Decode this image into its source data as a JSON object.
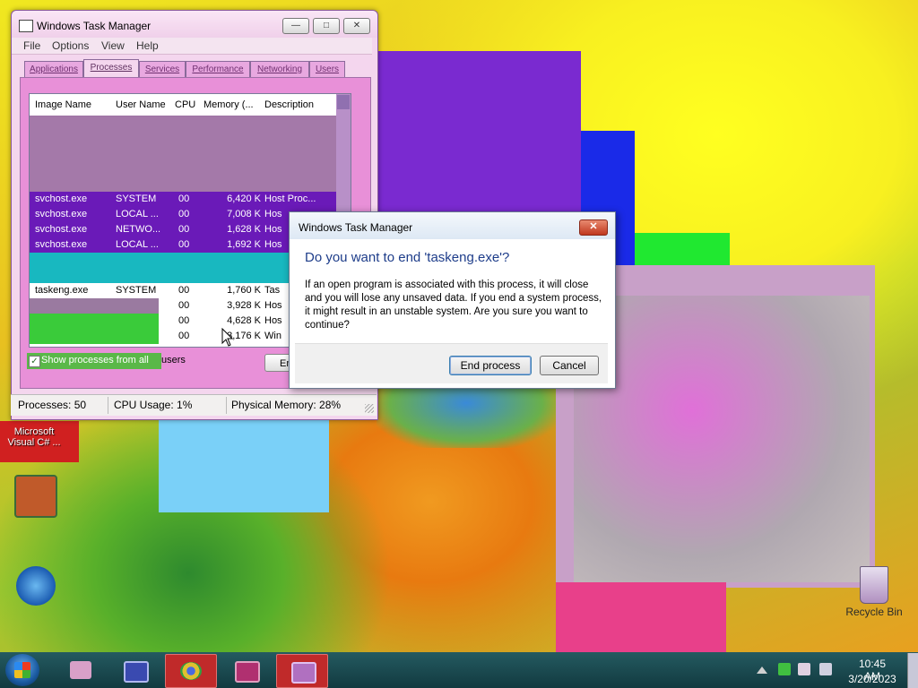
{
  "taskmanager": {
    "title": "Windows Task Manager",
    "menu": [
      "File",
      "Options",
      "View",
      "Help"
    ],
    "tabs": [
      "Applications",
      "Processes",
      "Services",
      "Performance",
      "Networking",
      "Users"
    ],
    "active_tab": "Processes",
    "columns": [
      "Image Name",
      "User Name",
      "CPU",
      "Memory (...",
      "Description"
    ],
    "rows": [
      {
        "image": "svchost.exe",
        "user": "SYSTEM",
        "cpu": "00",
        "mem": "6,420 K",
        "desc": "Host Proc...",
        "bg": "#6a1ab8",
        "fg": "#ffffff"
      },
      {
        "image": "svchost.exe",
        "user": "LOCAL ...",
        "cpu": "00",
        "mem": "7,008 K",
        "desc": "Hos",
        "bg": "#6a1ab8",
        "fg": "#ffffff"
      },
      {
        "image": "svchost.exe",
        "user": "NETWO...",
        "cpu": "00",
        "mem": "1,628 K",
        "desc": "Hos",
        "bg": "#6a1ab8",
        "fg": "#ffffff"
      },
      {
        "image": "svchost.exe",
        "user": "LOCAL ...",
        "cpu": "00",
        "mem": "1,692 K",
        "desc": "Hos",
        "bg": "#6a1ab8",
        "fg": "#ffffff"
      },
      {
        "image": "taskeng.exe",
        "user": "SYSTEM",
        "cpu": "00",
        "mem": "1,760 K",
        "desc": "Tas",
        "bg": "#ffffff",
        "fg": "#000000"
      },
      {
        "image": "",
        "user": "",
        "cpu": "00",
        "mem": "3,928 K",
        "desc": "Hos",
        "bg": "#ffffff",
        "fg": "#000000"
      },
      {
        "image": "",
        "user": "",
        "cpu": "00",
        "mem": "4,628 K",
        "desc": "Hos",
        "bg": "#ffffff",
        "fg": "#000000"
      },
      {
        "image": "",
        "user": "",
        "cpu": "00",
        "mem": "3,176 K",
        "desc": "Win",
        "bg": "#ffffff",
        "fg": "#000000"
      }
    ],
    "show_all_label": "Show processes from all",
    "show_all_label_tail": "users",
    "end_button": "En",
    "status": {
      "processes": "Processes: 50",
      "cpu": "CPU Usage: 1%",
      "memory": "Physical Memory: 28%"
    }
  },
  "dialog": {
    "title": "Windows Task Manager",
    "heading": "Do you want to end 'taskeng.exe'?",
    "message": "If an open program is associated with this process, it will close and you will lose any unsaved data. If you end a system process, it might result in an unstable system. Are you sure you want to continue?",
    "end_button": "End process",
    "cancel_button": "Cancel"
  },
  "desktop_icons": [
    {
      "label": "Microsoft Visual C# ...",
      "icon": "visual-csharp-icon"
    },
    {
      "label": "Recycle Bin",
      "icon": "recycle-bin-icon"
    }
  ],
  "taskbar": {
    "time": "10:45 AM",
    "date": "3/20/2023"
  },
  "colors": {
    "heading_blue": "#1e3d8a",
    "taskbar": "#184a50",
    "dialog_close": "#c0381e"
  }
}
